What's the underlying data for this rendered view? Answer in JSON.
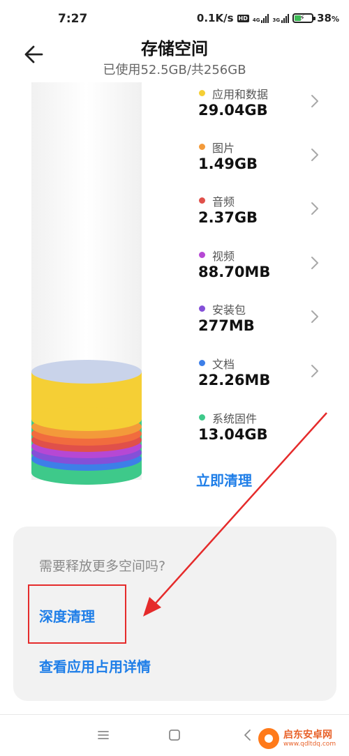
{
  "status_bar": {
    "time": "7:27",
    "network_speed": "0.1K/s",
    "hd_badge": "HD",
    "signal1_tag": "4G",
    "signal2_tag": "3G",
    "battery_percent": "38",
    "battery_unit": "%",
    "battery_level": 0.38
  },
  "header": {
    "title": "存储空间",
    "subtitle": "已使用52.5GB/共256GB"
  },
  "categories": [
    {
      "name": "应用和数据",
      "size": "29.04GB",
      "color": "#f5cf35"
    },
    {
      "name": "图片",
      "size": "1.49GB",
      "color": "#f39a3a"
    },
    {
      "name": "音频",
      "size": "2.37GB",
      "color": "#e0504a"
    },
    {
      "name": "视频",
      "size": "88.70MB",
      "color": "#b648d4"
    },
    {
      "name": "安装包",
      "size": "277MB",
      "color": "#8450d8"
    },
    {
      "name": "文档",
      "size": "22.26MB",
      "color": "#3d7fe8"
    },
    {
      "name": "系统固件",
      "size": "13.04GB",
      "color": "#3ec98a"
    }
  ],
  "clean_now_label": "立即清理",
  "card": {
    "question": "需要释放更多空间吗?",
    "deep_clean_label": "深度清理",
    "app_usage_label": "查看应用占用详情"
  },
  "watermark": {
    "main": "启东安卓网",
    "sub": "www.qdltdq.com"
  },
  "colors": {
    "accent": "#1e7ee8",
    "annotation": "#e52b2b"
  }
}
